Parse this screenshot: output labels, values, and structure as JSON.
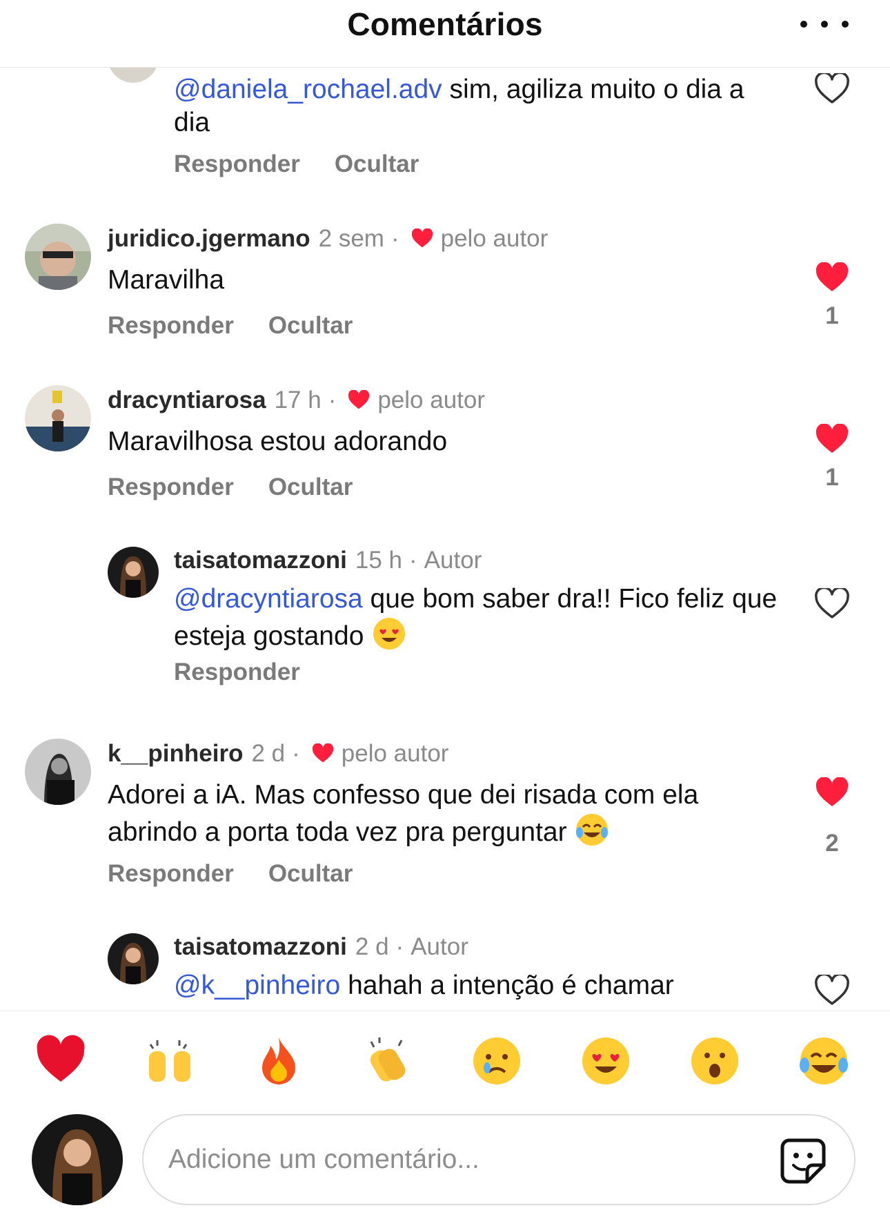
{
  "header": {
    "title": "Comentários",
    "more_icon": "more-horizontal-icon"
  },
  "comments": [
    {
      "mention": "@daniela_rochael.adv",
      "text": " sim, agiliza muito o dia a dia",
      "reply": "Responder",
      "hide": "Ocultar",
      "liked": false
    },
    {
      "username": "juridico.jgermano",
      "time": "2 sem",
      "sep": "·",
      "liked_by": "pelo autor",
      "text": "Maravilha",
      "reply": "Responder",
      "hide": "Ocultar",
      "liked": true,
      "likes": "1"
    },
    {
      "username": "dracyntiarosa",
      "time": "17 h",
      "sep": "·",
      "liked_by": "pelo autor",
      "text": "Maravilhosa estou adorando",
      "reply": "Responder",
      "hide": "Ocultar",
      "liked": true,
      "likes": "1"
    },
    {
      "username": "taisatomazzoni",
      "time": "15 h",
      "sep": "·",
      "role": "Autor",
      "mention": "@dracyntiarosa",
      "text": " que bom saber dra!! Fico feliz que esteja gostando",
      "emoji": "smiling-face-with-heart-eyes",
      "reply": "Responder",
      "liked": false
    },
    {
      "username": "k__pinheiro",
      "time": "2 d",
      "sep": "·",
      "liked_by": "pelo autor",
      "text": "Adorei a iA. Mas confesso que dei risada com ela abrindo a porta toda vez pra perguntar",
      "emoji": "face-with-tears-of-joy",
      "reply": "Responder",
      "hide": "Ocultar",
      "liked": true,
      "likes": "2"
    },
    {
      "username": "taisatomazzoni",
      "time": "2 d",
      "sep": "·",
      "role": "Autor",
      "mention": "@k__pinheiro",
      "text": " hahah a intenção é chamar",
      "liked": false
    }
  ],
  "reactions": [
    "red-heart",
    "raising-hands",
    "fire",
    "clapping-hands",
    "crying-face",
    "heart-eyes-face",
    "surprised-face",
    "tears-of-joy-face"
  ],
  "composer": {
    "placeholder": "Adicione um comentário...",
    "sticker_icon": "sticker-icon"
  },
  "colors": {
    "mention": "#3558d6",
    "heart": "#ff1f3d",
    "muted": "#8a8a8a"
  }
}
